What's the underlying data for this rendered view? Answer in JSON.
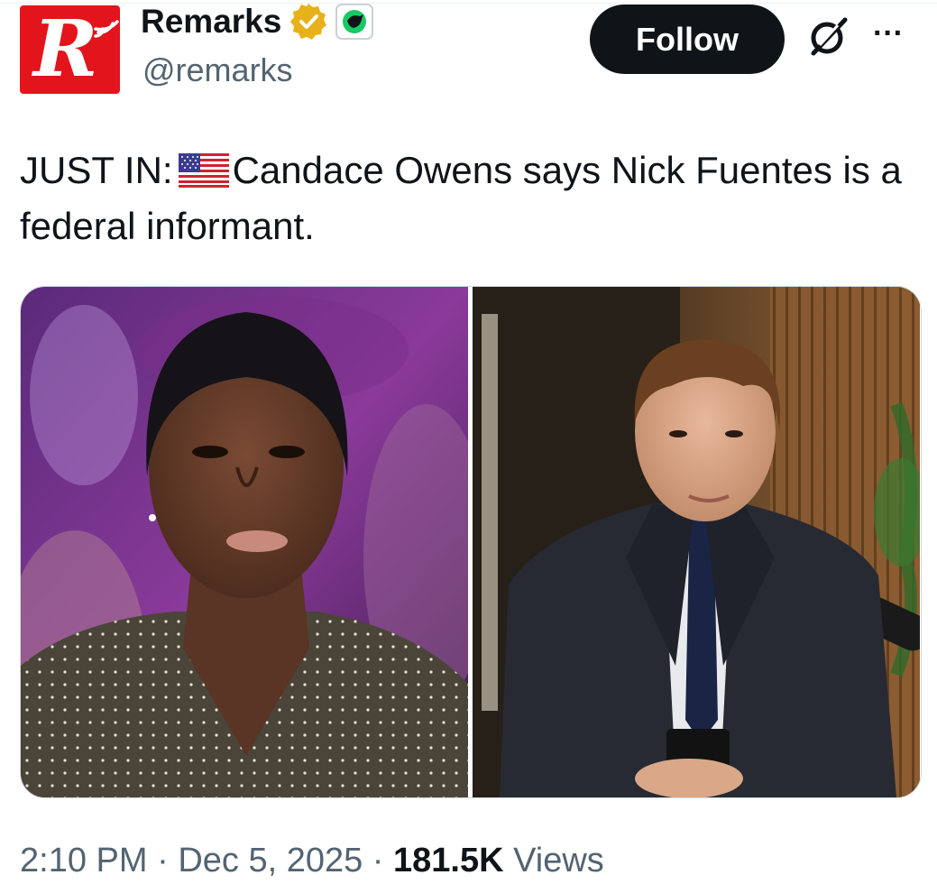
{
  "account": {
    "name": "Remarks",
    "handle": "@remarks",
    "avatar_letter": "R",
    "verified_icon": "gold-verified-badge-icon",
    "affiliate_icon": "green-bird-badge-icon"
  },
  "actions": {
    "follow_label": "Follow",
    "grok_icon": "grok-icon",
    "more_label": "···"
  },
  "tweet": {
    "text_before_flag": "JUST IN:",
    "flag_icon": "us-flag-emoji",
    "text_after_flag": "Candace Owens says Nick Fuentes is a federal informant."
  },
  "media": {
    "left_photo": "woman-portrait-photo",
    "right_photo": "man-in-suit-photo"
  },
  "meta": {
    "time": "2:10 PM",
    "separator": "·",
    "date": "Dec 5, 2025",
    "views_count": "181.5K",
    "views_label": "Views"
  },
  "colors": {
    "brand_red": "#e3141b",
    "follow_bg": "#0f1419",
    "text_primary": "#0f1419",
    "text_secondary": "#536471",
    "verified_gold": "#e8b11a"
  }
}
